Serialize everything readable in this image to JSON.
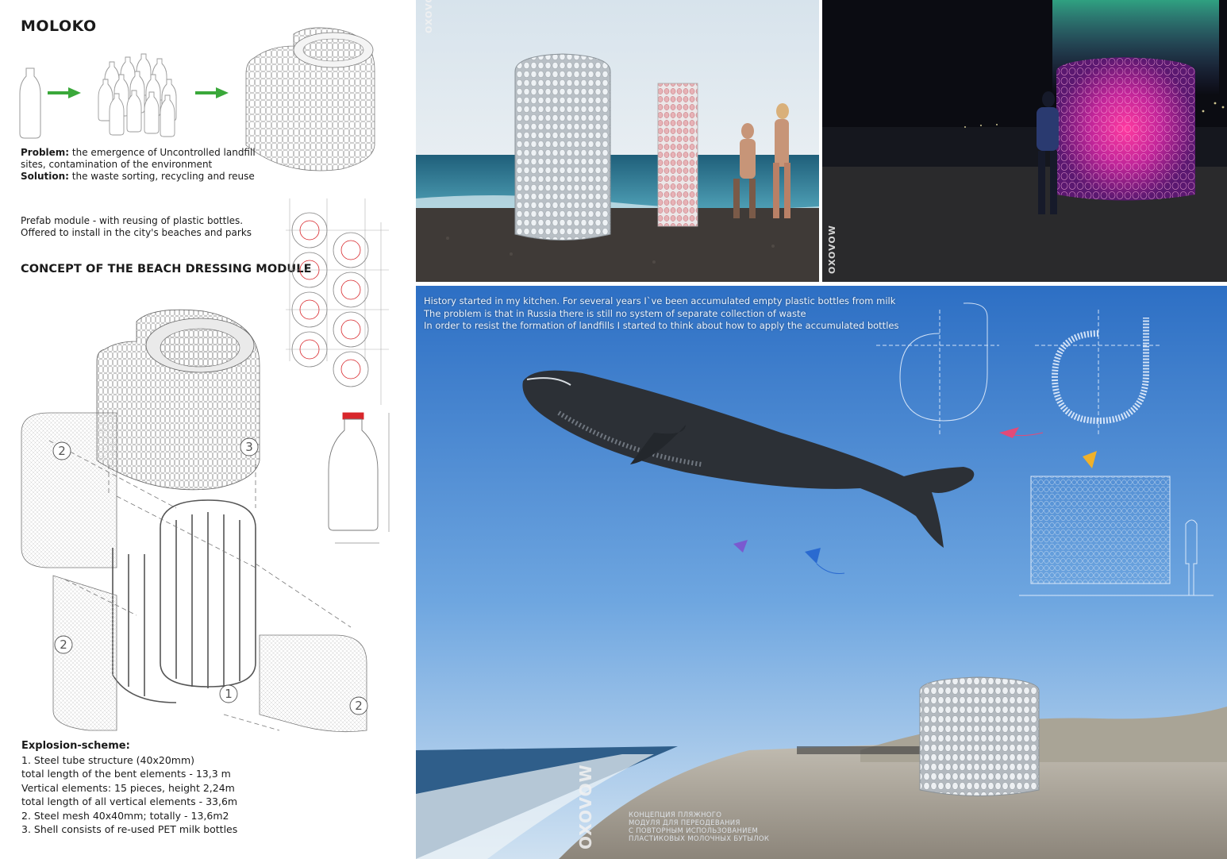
{
  "project": {
    "title": "MOLOKO"
  },
  "intro": {
    "problem_label": "Problem:",
    "problem_text_1": " the emergence of Uncontrolled landfill",
    "problem_text_2": "sites, contamination of the environment",
    "solution_label": "Solution:",
    "solution_text": " the waste sorting, recycling and reuse",
    "prefab_1": "Prefab module - with reusing of plastic bottles.",
    "prefab_2": "Offered to install in the city's beaches and parks"
  },
  "concept": {
    "heading": "CONCEPT OF THE BEACH DRESSING MODULE"
  },
  "explosion": {
    "heading": "Explosion-scheme:",
    "lines": [
      "1. Steel tube structure (40x20mm)",
      "total length of the bent elements - 13,3 m",
      "Vertical elements: 15 pieces, height 2,24m",
      "total length of all vertical elements - 33,6m",
      "2. Steel mesh 40x40mm; totally - 13,6m2",
      "3. Shell consists of re-used PET milk bottles"
    ],
    "markers": [
      "1",
      "2",
      "2",
      "2",
      "3"
    ]
  },
  "story": {
    "line1": "History started in my kitchen. For several years I`ve been accumulated empty plastic bottles from milk",
    "line2": "The problem is that in Russia there is still no system of separate collection of waste",
    "line3": "In order to resist the formation of landfills I started to think about how to apply the accumulated bottles"
  },
  "logo": {
    "mirror_text": "OXOVOW"
  },
  "russian_caption": {
    "lines": [
      "КОНЦЕПЦИЯ ПЛЯЖНОГО",
      "МОДУЛЯ ДЛЯ ПЕРЕОДЕВАНИЯ",
      "С ПОВТОРНЫМ ИСПОЛЬЗОВАНИЕМ",
      "ПЛАСТИКОВЫХ МОЛОЧНЫХ БУТЫЛОК"
    ]
  },
  "colors": {
    "arrow_green": "#3aa83a",
    "bottle_cap_red": "#d8262b",
    "sky_blue": "#3f86d6",
    "night_magenta": "#d02aa0"
  }
}
